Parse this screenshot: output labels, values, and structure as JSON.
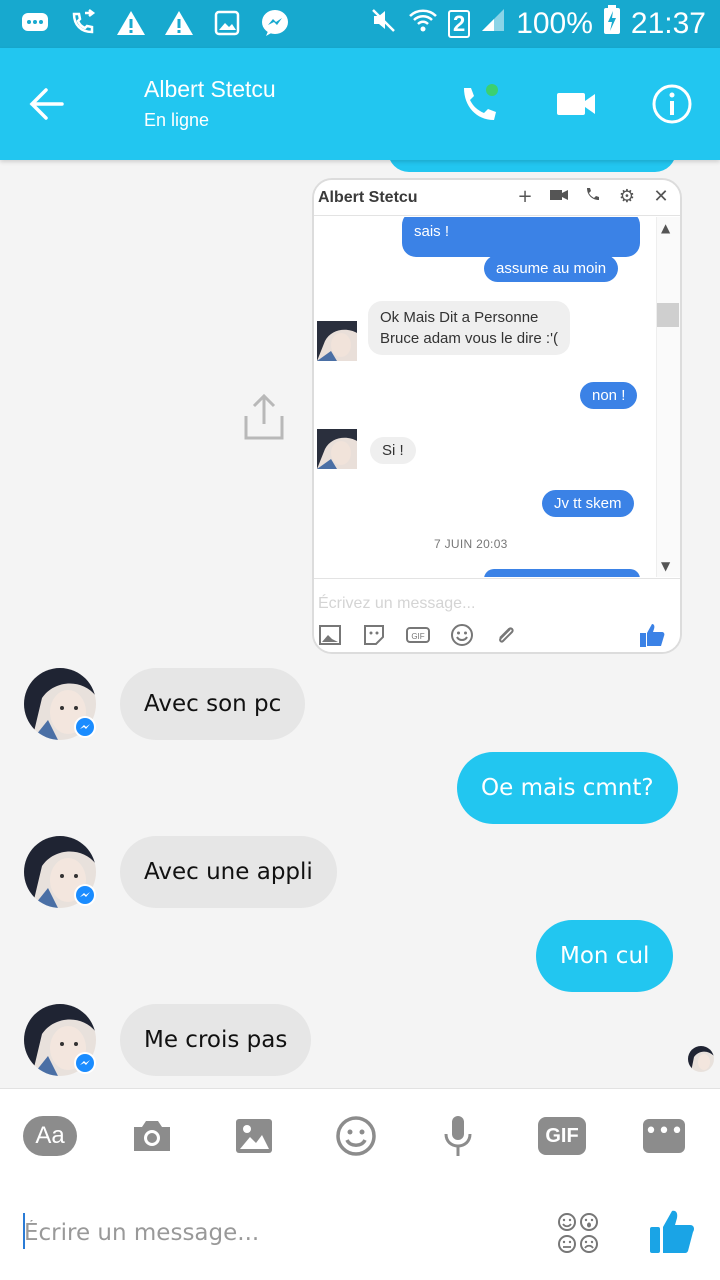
{
  "status_bar": {
    "battery": "100%",
    "time": "21:37",
    "sim": "2"
  },
  "header": {
    "contact_name": "Albert Stetcu",
    "contact_status": "En ligne",
    "accent_color": "#22c6f0"
  },
  "screenshot": {
    "window_title": "Albert Stetcu",
    "messages": [
      {
        "from": "me",
        "text": "sais !"
      },
      {
        "from": "me",
        "text": "assume au moin"
      },
      {
        "from": "them",
        "text": "Ok Mais Dit a Personne\nBruce adam vous le dire :'("
      },
      {
        "from": "me",
        "text": "non !"
      },
      {
        "from": "them",
        "text": "Si !"
      },
      {
        "from": "me",
        "text": "Jv tt skem"
      }
    ],
    "date_separator": "7 JUIN 20:03",
    "input_placeholder": "Écrivez un message..."
  },
  "messages": [
    {
      "from": "them",
      "text": "Avec son pc"
    },
    {
      "from": "me",
      "text": "Oe mais cmnt?"
    },
    {
      "from": "them",
      "text": "Avec une appli"
    },
    {
      "from": "me",
      "text": "Mon cul"
    },
    {
      "from": "them",
      "text": "Me crois pas"
    }
  ],
  "composer": {
    "aa_label": "Aa",
    "gif_label": "GIF",
    "placeholder": "Écrire un message..."
  }
}
